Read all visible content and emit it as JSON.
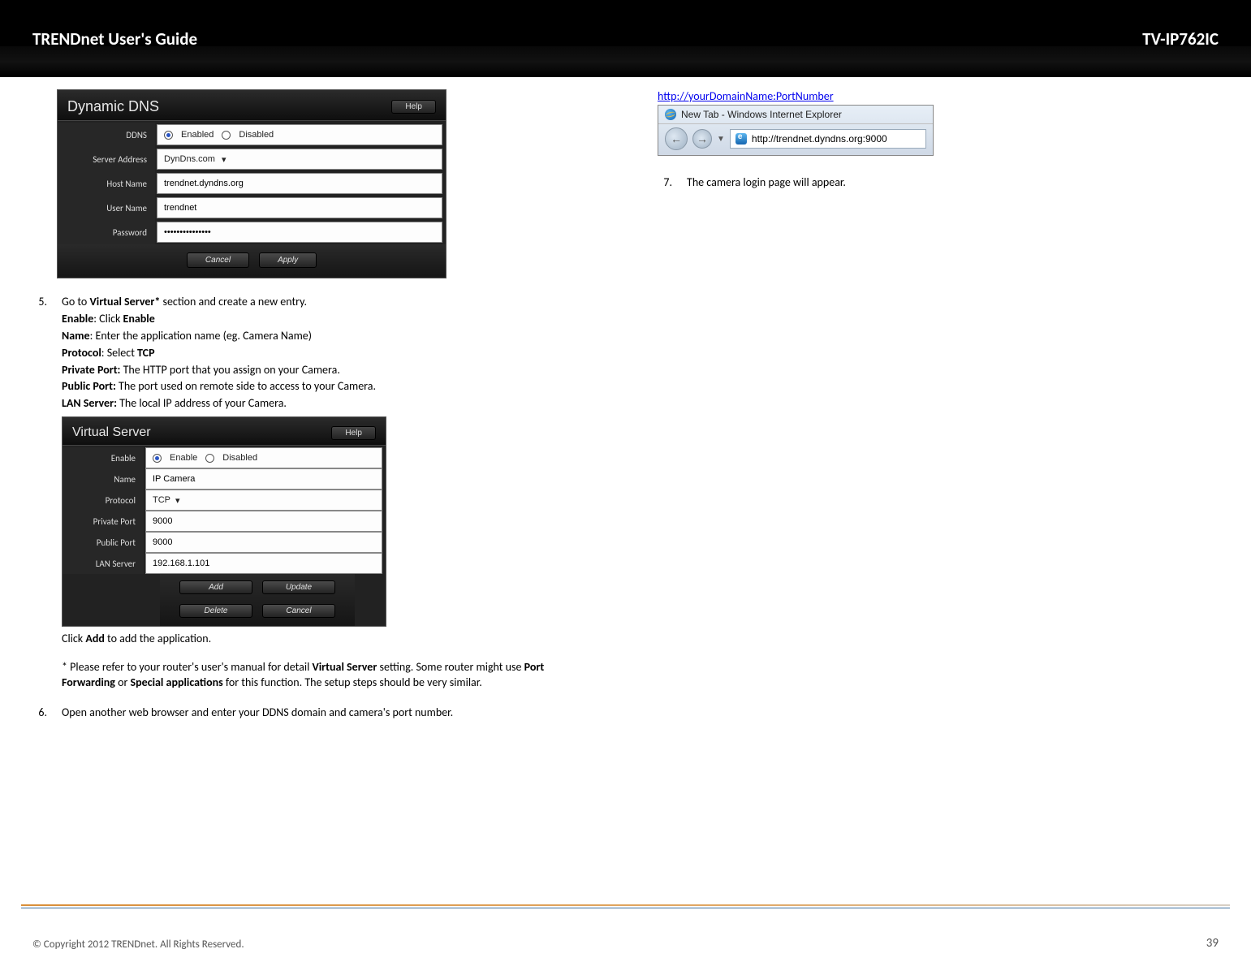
{
  "header": {
    "left": "TRENDnet User's Guide",
    "right": "TV-IP762IC"
  },
  "ddns_panel": {
    "title": "Dynamic DNS",
    "help": "Help",
    "rows": {
      "ddns_label": "DDNS",
      "enabled": "Enabled",
      "disabled": "Disabled",
      "server_label": "Server Address",
      "server_value": "DynDns.com",
      "host_label": "Host Name",
      "host_value": "trendnet.dyndns.org",
      "user_label": "User Name",
      "user_value": "trendnet",
      "pass_label": "Password",
      "pass_value": "•••••••••••••••"
    },
    "buttons": {
      "cancel": "Cancel",
      "apply": "Apply"
    }
  },
  "step5": {
    "num": "5.",
    "intro_pre": "Go to ",
    "intro_bold": "Virtual Server*",
    "intro_post": " section and create a new entry.",
    "enable_l": "Enable",
    "enable_t": ": Click ",
    "enable_b": "Enable",
    "name_l": "Name",
    "name_t": ": Enter the application name (eg. Camera Name)",
    "proto_l": "Protocol",
    "proto_t": ": Select ",
    "proto_b": "TCP",
    "priv_l": "Private Port:",
    "priv_t": " The HTTP port that you assign on your Camera.",
    "pub_l": "Public Port:",
    "pub_t": " The port used on remote side to access to your Camera.",
    "lan_l": "LAN Server:",
    "lan_t": " The local IP address of your Camera.",
    "click_pre": "Click ",
    "click_bold": "Add",
    "click_post": " to add the application.",
    "note1_pre": "* Please refer to your router's user's manual for detail ",
    "note1_b": "Virtual Server",
    "note1_post": " setting. Some router might use ",
    "note1_b2": "Port Forwarding",
    "note1_mid": " or ",
    "note1_b3": "Special applications",
    "note1_end": " for this function.  The setup steps should be very similar."
  },
  "vs_panel": {
    "title": "Virtual Server",
    "help": "Help",
    "rows": {
      "enable_label": "Enable",
      "enable_opt": "Enable",
      "disabled_opt": "Disabled",
      "name_label": "Name",
      "name_value": "IP Camera",
      "proto_label": "Protocol",
      "proto_value": "TCP",
      "priv_label": "Private Port",
      "priv_value": "9000",
      "pub_label": "Public Port",
      "pub_value": "9000",
      "lan_label": "LAN Server",
      "lan_value": "192.168.1.101"
    },
    "buttons": {
      "add": "Add",
      "update": "Update",
      "delete": "Delete",
      "cancel": "Cancel"
    }
  },
  "step6": {
    "num": "6.",
    "text": "Open another web browser and enter your DDNS domain and camera's port number."
  },
  "right_col": {
    "url": "http://yourDomainName:PortNumber",
    "ie_title": "New Tab - Windows Internet Explorer",
    "ie_url": "http://trendnet.dyndns.org:9000"
  },
  "step7": {
    "num": "7.",
    "text": "The camera login page will appear."
  },
  "footer": {
    "copyright": "© Copyright 2012 TRENDnet. All Rights Reserved.",
    "page": "39"
  }
}
